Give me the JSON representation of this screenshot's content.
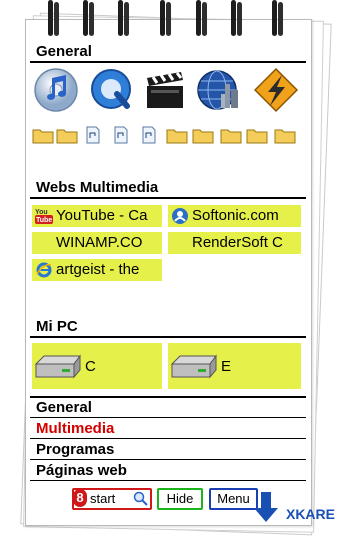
{
  "sections": {
    "general": "General",
    "webs": "Webs Multimedia",
    "mipc": "Mi PC"
  },
  "apps": [
    {
      "icon": "itunes-icon"
    },
    {
      "icon": "quicktime-icon"
    },
    {
      "icon": "clapperboard-icon"
    },
    {
      "icon": "globe-city-icon"
    },
    {
      "icon": "winamp-icon"
    }
  ],
  "links": [
    {
      "label": "YouTube  - Ca",
      "icon": "youtube-icon"
    },
    {
      "label": "Softonic.com",
      "icon": "softonic-icon"
    },
    {
      "label": "WINAMP.CO",
      "icon": ""
    },
    {
      "label": "RenderSoft C",
      "icon": ""
    },
    {
      "label": "artgeist - the",
      "icon": "internet-explorer-icon"
    }
  ],
  "drives": [
    {
      "label": "C"
    },
    {
      "label": "E"
    }
  ],
  "menu": [
    {
      "label": "General",
      "color": "#000000"
    },
    {
      "label": "Multimedia",
      "color": "#d40000"
    },
    {
      "label": "Programas",
      "color": "#000000"
    },
    {
      "label": "Páginas web",
      "color": "#000000"
    }
  ],
  "buttons": {
    "start": "start",
    "start_badge": "8",
    "hide": "Hide",
    "menu": "Menu"
  },
  "watermark": "XKARE",
  "colors": {
    "highlight": "#e6f04a",
    "accent_red": "#d40000"
  }
}
